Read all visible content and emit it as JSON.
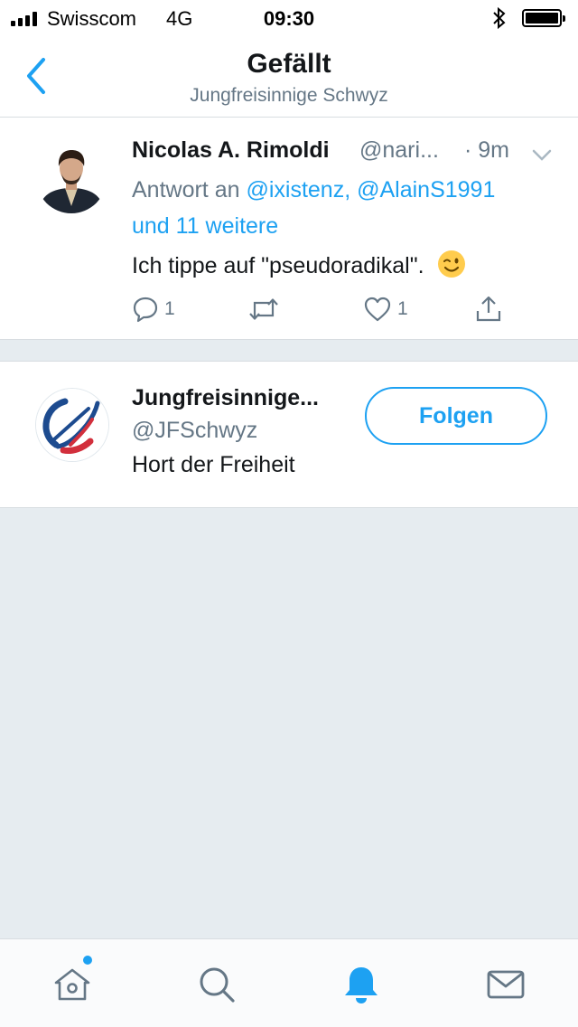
{
  "status_bar": {
    "carrier": "Swisscom",
    "network": "4G",
    "time": "09:30",
    "signal_bars": 4,
    "icons": [
      "signal-icon",
      "bluetooth-icon",
      "battery-icon"
    ]
  },
  "header": {
    "title": "Gefällt",
    "subtitle": "Jungfreisinnige Schwyz",
    "back_icon": "chevron-left-icon"
  },
  "tweet": {
    "author_name": "Nicolas A. Rimoldi",
    "author_handle": "@nari...",
    "time": "· 9m",
    "reply_prefix": "Antwort an",
    "mentions": "@ixistenz, @AlainS1991",
    "mentions_more": "und 11 weitere",
    "text": "Ich tippe auf \"pseudoradikal\".",
    "emoji": "winking-face",
    "reply_count": "1",
    "like_count": "1"
  },
  "account": {
    "name": "Jungfreisinnige...",
    "handle": "@JFSchwyz",
    "bio": "Hort der Freiheit",
    "follow_label": "Folgen"
  },
  "tab_bar": {
    "tabs": [
      "home-icon",
      "search-icon",
      "notifications-icon",
      "messages-icon"
    ],
    "active_tab": "notifications-icon"
  },
  "colors": {
    "accent": "#1da1f2",
    "secondary_text": "#657786",
    "background": "#e6ecf0"
  }
}
